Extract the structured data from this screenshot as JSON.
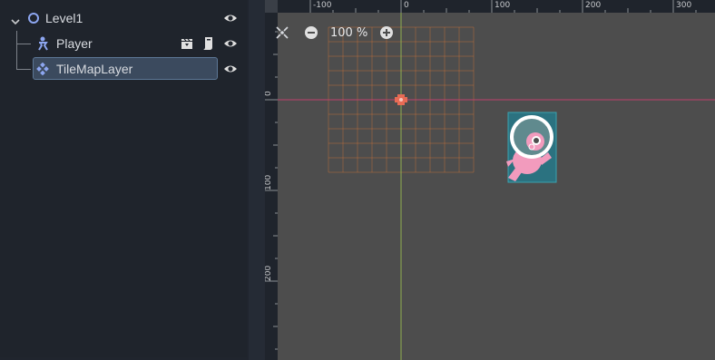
{
  "scene_tree": {
    "nodes": [
      {
        "label": "Level1",
        "icon": "node2d-circle-icon"
      },
      {
        "label": "Player",
        "icon": "character-body-icon",
        "badges": [
          "clapperboard-icon",
          "script-icon"
        ]
      },
      {
        "label": "TileMapLayer",
        "icon": "tilemap-icon",
        "selected": true
      }
    ]
  },
  "viewport": {
    "zoom_label": "100 %",
    "ruler_top_labels": [
      "-100",
      "0",
      "100",
      "200",
      "300"
    ],
    "ruler_left_labels": [
      "0",
      "100",
      "200"
    ]
  },
  "colors": {
    "panel_bg": "#1f242c",
    "viewport_bg": "#4d4d4d",
    "selection_bg": "#3b4a5e",
    "x_axis": "#c0416d",
    "y_axis": "#8fb050",
    "grid": "#c8703a",
    "accent_blue": "#8da6f0"
  }
}
